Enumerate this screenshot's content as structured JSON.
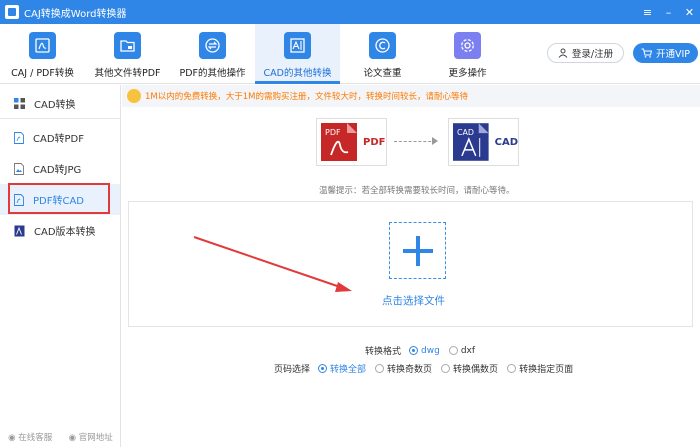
{
  "app": {
    "title": "CAJ转换成Word转换器"
  },
  "toolbar": {
    "items": [
      {
        "label": "CAJ / PDF转换",
        "icon": "pdf-doc-icon"
      },
      {
        "label": "其他文件转PDF",
        "icon": "folder-icon"
      },
      {
        "label": "PDF的其他操作",
        "icon": "swap-icon"
      },
      {
        "label": "CAD的其他转换",
        "icon": "cad-board-icon"
      },
      {
        "label": "论文查重",
        "icon": "c-circle-icon"
      },
      {
        "label": "更多操作",
        "icon": "gear-icon"
      }
    ],
    "login_label": "登录/注册",
    "vip_label": "开通VIP"
  },
  "sidebar": {
    "items": [
      {
        "label": "CAD转换",
        "icon": "grid-icon"
      },
      {
        "label": "CAD转PDF",
        "icon": "pdf-file-icon"
      },
      {
        "label": "CAD转JPG",
        "icon": "image-file-icon"
      },
      {
        "label": "PDF转CAD",
        "icon": "pdf-file-icon"
      },
      {
        "label": "CAD版本转换",
        "icon": "cad-file-icon"
      }
    ],
    "footer": {
      "service": "在线客服",
      "website": "官网地址"
    }
  },
  "notice": {
    "text": "1M以内的免费转换，大于1M的需购买注册，文件较大时，转换时间较长，请耐心等待"
  },
  "conversion": {
    "from_badge": "PDF",
    "from_label": "PDF",
    "to_badge": "CAD",
    "to_label": "CAD"
  },
  "tip": {
    "text": "温馨提示：若全部转换需要较长时间，请耐心等待。"
  },
  "upload": {
    "label": "点击选择文件"
  },
  "format": {
    "label": "转换格式",
    "options": [
      {
        "label": "dwg",
        "checked": true
      },
      {
        "label": "dxf",
        "checked": false
      }
    ]
  },
  "pages": {
    "label": "页码选择",
    "options": [
      {
        "label": "转换全部",
        "checked": true
      },
      {
        "label": "转换奇数页",
        "checked": false
      },
      {
        "label": "转换偶数页",
        "checked": false
      },
      {
        "label": "转换指定页面",
        "checked": false
      }
    ]
  },
  "colors": {
    "accent": "#2f86e6",
    "pdf_red": "#c62828",
    "cad_navy": "#2a3a8f",
    "annotation": "#e23a3a",
    "notice_text": "#ff7a00"
  }
}
